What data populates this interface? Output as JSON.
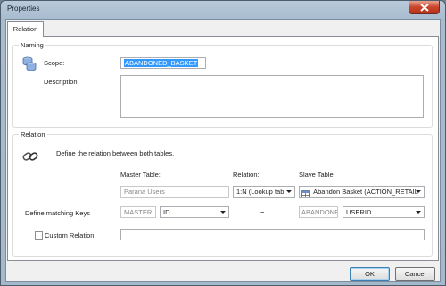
{
  "window": {
    "title": "Properties"
  },
  "tabs": [
    {
      "label": "Relation"
    }
  ],
  "naming": {
    "group_title": "Naming",
    "scope_label": "Scope:",
    "scope_value": "ABANDONED_BASKET",
    "description_label": "Description:",
    "description_value": ""
  },
  "relation": {
    "group_title": "Relation",
    "intro_text": "Define the relation between both tables.",
    "master_table_label": "Master Table:",
    "relation_label": "Relation:",
    "slave_table_label": "Slave Table:",
    "master_table_value": "Parana Users",
    "relation_value": "1:N (Lookup table",
    "slave_table_value": "Abandon Basket (ACTION_RETAIL_A",
    "matching_keys_label": "Define matching Keys",
    "master_alias": "MASTER",
    "master_key": "ID",
    "equals_sign": "=",
    "slave_alias": "ABANDONED",
    "slave_key": "USERID",
    "custom_relation_label": "Custom Relation",
    "custom_relation_checked": false,
    "custom_relation_value": ""
  },
  "buttons": {
    "ok_label": "OK",
    "cancel_label": "Cancel"
  },
  "icons": {
    "close": "close-icon",
    "scope": "database-icon",
    "relation": "chain-link-icon",
    "slave_table": "table-icon"
  }
}
